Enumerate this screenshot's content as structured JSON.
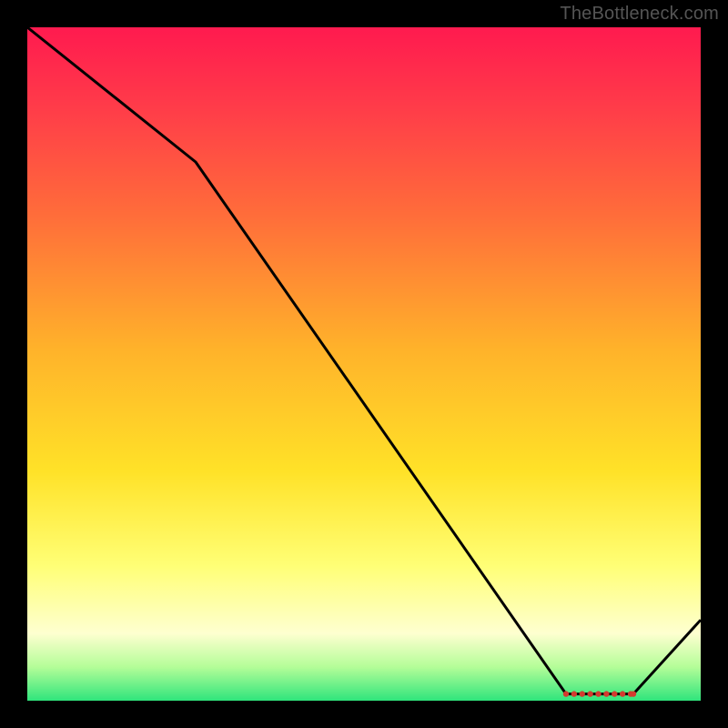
{
  "watermark": "TheBottleneck.com",
  "chart_data": {
    "type": "line",
    "title": "",
    "xlabel": "",
    "ylabel": "",
    "xlim": [
      0,
      100
    ],
    "ylim": [
      0,
      100
    ],
    "grid": false,
    "legend": false,
    "series": [
      {
        "name": "bottleneck-curve",
        "x": [
          0,
          25,
          80,
          90,
          100
        ],
        "y": [
          100,
          80,
          1,
          1,
          12
        ],
        "color": "#000000"
      }
    ],
    "markers": {
      "name": "baseline-dots",
      "x": [
        80,
        81.2,
        82.4,
        83.6,
        84.8,
        86,
        87.2,
        88.4,
        89.6,
        90
      ],
      "y": 1,
      "color": "#d33b2f",
      "radius": 3.2
    },
    "gradient_stops": [
      {
        "pos": 0.0,
        "color": "#ff1a4f"
      },
      {
        "pos": 0.12,
        "color": "#ff3c49"
      },
      {
        "pos": 0.28,
        "color": "#ff6d3a"
      },
      {
        "pos": 0.48,
        "color": "#ffb32a"
      },
      {
        "pos": 0.66,
        "color": "#ffe228"
      },
      {
        "pos": 0.8,
        "color": "#ffff76"
      },
      {
        "pos": 0.9,
        "color": "#feffd0"
      },
      {
        "pos": 0.95,
        "color": "#b4fd98"
      },
      {
        "pos": 1.0,
        "color": "#2fe57c"
      }
    ]
  }
}
